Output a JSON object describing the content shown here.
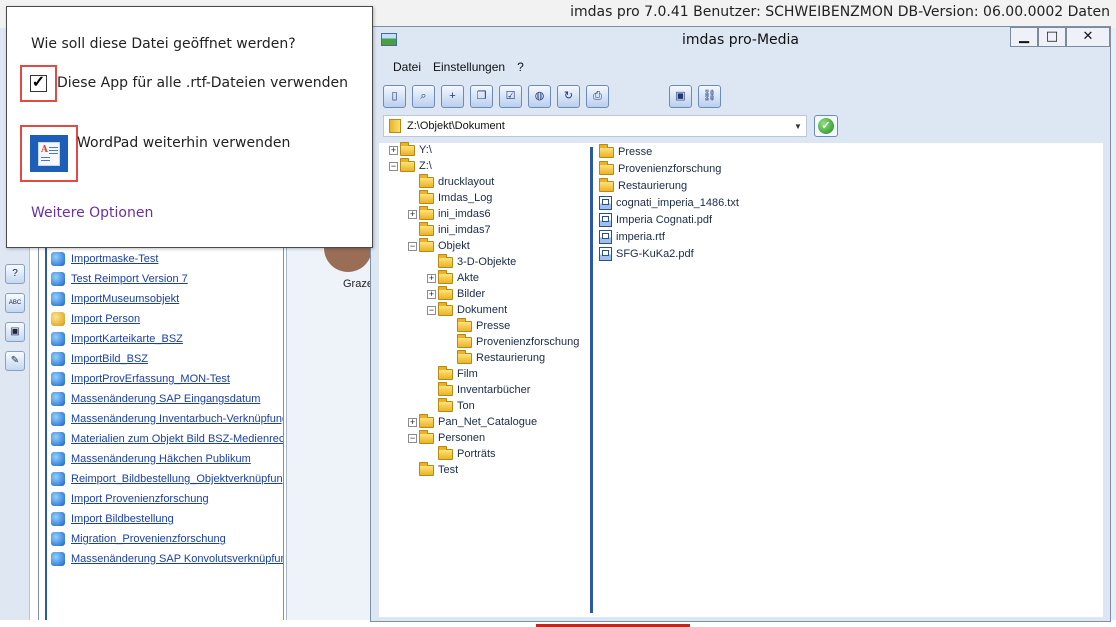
{
  "background_app": {
    "title": "imdas pro 7.0.41 Benutzer: SCHWEIBENZMON   DB-Version: 06.00.0002   Daten",
    "caption": "Graze",
    "list_items": [
      {
        "label": "Importmaske-Test",
        "icon": "import-icon"
      },
      {
        "label": "Test Reimport Version 7",
        "icon": "import-icon"
      },
      {
        "label": "ImportMuseumsobjekt",
        "icon": "import-icon"
      },
      {
        "label": "Import Person",
        "icon": "person-icon"
      },
      {
        "label": "ImportKarteikarte_BSZ",
        "icon": "import-icon"
      },
      {
        "label": "ImportBild_BSZ",
        "icon": "import-icon"
      },
      {
        "label": "ImportProvErfassung_MON-Test",
        "icon": "import-icon"
      },
      {
        "label": "Massenänderung SAP Eingangsdatum",
        "icon": "import-icon"
      },
      {
        "label": "Massenänderung Inventarbuch-Verknüpfung",
        "icon": "import-icon"
      },
      {
        "label": "Materialien zum Objekt Bild BSZ-Medienrecht",
        "icon": "import-icon"
      },
      {
        "label": "Massenänderung Häkchen Publikum",
        "icon": "import-icon"
      },
      {
        "label": "Reimport_Bildbestellung_Objektverknüpfung",
        "icon": "import-icon"
      },
      {
        "label": "Import Provenienzforschung",
        "icon": "import-icon"
      },
      {
        "label": "Import Bildbestellung",
        "icon": "import-icon"
      },
      {
        "label": "Migration_Provenienzforschung",
        "icon": "import-icon"
      },
      {
        "label": "Massenänderung SAP Konvolutsverknüpfung",
        "icon": "import-icon"
      }
    ],
    "left_tools": [
      "help-icon",
      "spellcheck-icon",
      "image-icon",
      "edit-icon"
    ]
  },
  "dialog": {
    "question": "Wie soll diese Datei geöffnet werden?",
    "always_checked": true,
    "always_label": "Diese App für alle .rtf-Dateien verwenden",
    "app_label": "WordPad weiterhin verwenden",
    "more_options": "Weitere Optionen"
  },
  "media_window": {
    "title": "imdas pro-Media",
    "buttons": {
      "minimize": "▁",
      "maximize": "□",
      "close": "✕"
    },
    "menu": [
      "Datei",
      "Einstellungen",
      "?"
    ],
    "toolbar_icons": [
      "exit-icon",
      "search-icon",
      "add-icon",
      "copy-icon",
      "checklist-icon",
      "web-icon",
      "refresh-icon",
      "print-icon",
      "image-icon",
      "link-icon"
    ],
    "path": "Z:\\Objekt\\Dokument",
    "tree": [
      {
        "label": "Y:\\",
        "expander": "+",
        "level": 0
      },
      {
        "label": "Z:\\",
        "expander": "-",
        "level": 0
      },
      {
        "label": "drucklayout",
        "expander": "",
        "level": 1
      },
      {
        "label": "Imdas_Log",
        "expander": "",
        "level": 1
      },
      {
        "label": "ini_imdas6",
        "expander": "+",
        "level": 1
      },
      {
        "label": "ini_imdas7",
        "expander": "",
        "level": 1
      },
      {
        "label": "Objekt",
        "expander": "-",
        "level": 1
      },
      {
        "label": "3-D-Objekte",
        "expander": "",
        "level": 2
      },
      {
        "label": "Akte",
        "expander": "+",
        "level": 2
      },
      {
        "label": "Bilder",
        "expander": "+",
        "level": 2
      },
      {
        "label": "Dokument",
        "expander": "-",
        "level": 2
      },
      {
        "label": "Presse",
        "expander": "",
        "level": 3
      },
      {
        "label": "Provenienzforschung",
        "expander": "",
        "level": 3
      },
      {
        "label": "Restaurierung",
        "expander": "",
        "level": 3
      },
      {
        "label": "Film",
        "expander": "",
        "level": 2
      },
      {
        "label": "Inventarbücher",
        "expander": "",
        "level": 2
      },
      {
        "label": "Ton",
        "expander": "",
        "level": 2
      },
      {
        "label": "Pan_Net_Catalogue",
        "expander": "+",
        "level": 1
      },
      {
        "label": "Personen",
        "expander": "-",
        "level": 1
      },
      {
        "label": "Porträts",
        "expander": "",
        "level": 2
      },
      {
        "label": "Test",
        "expander": "",
        "level": 1
      }
    ],
    "files": [
      {
        "label": "Presse",
        "type": "folder"
      },
      {
        "label": "Provenienzforschung",
        "type": "folder"
      },
      {
        "label": "Restaurierung",
        "type": "folder"
      },
      {
        "label": "cognati_imperia_1486.txt",
        "type": "file"
      },
      {
        "label": "Imperia Cognati.pdf",
        "type": "file"
      },
      {
        "label": "imperia.rtf",
        "type": "file"
      },
      {
        "label": "SFG-KuKa2.pdf",
        "type": "file"
      }
    ]
  }
}
